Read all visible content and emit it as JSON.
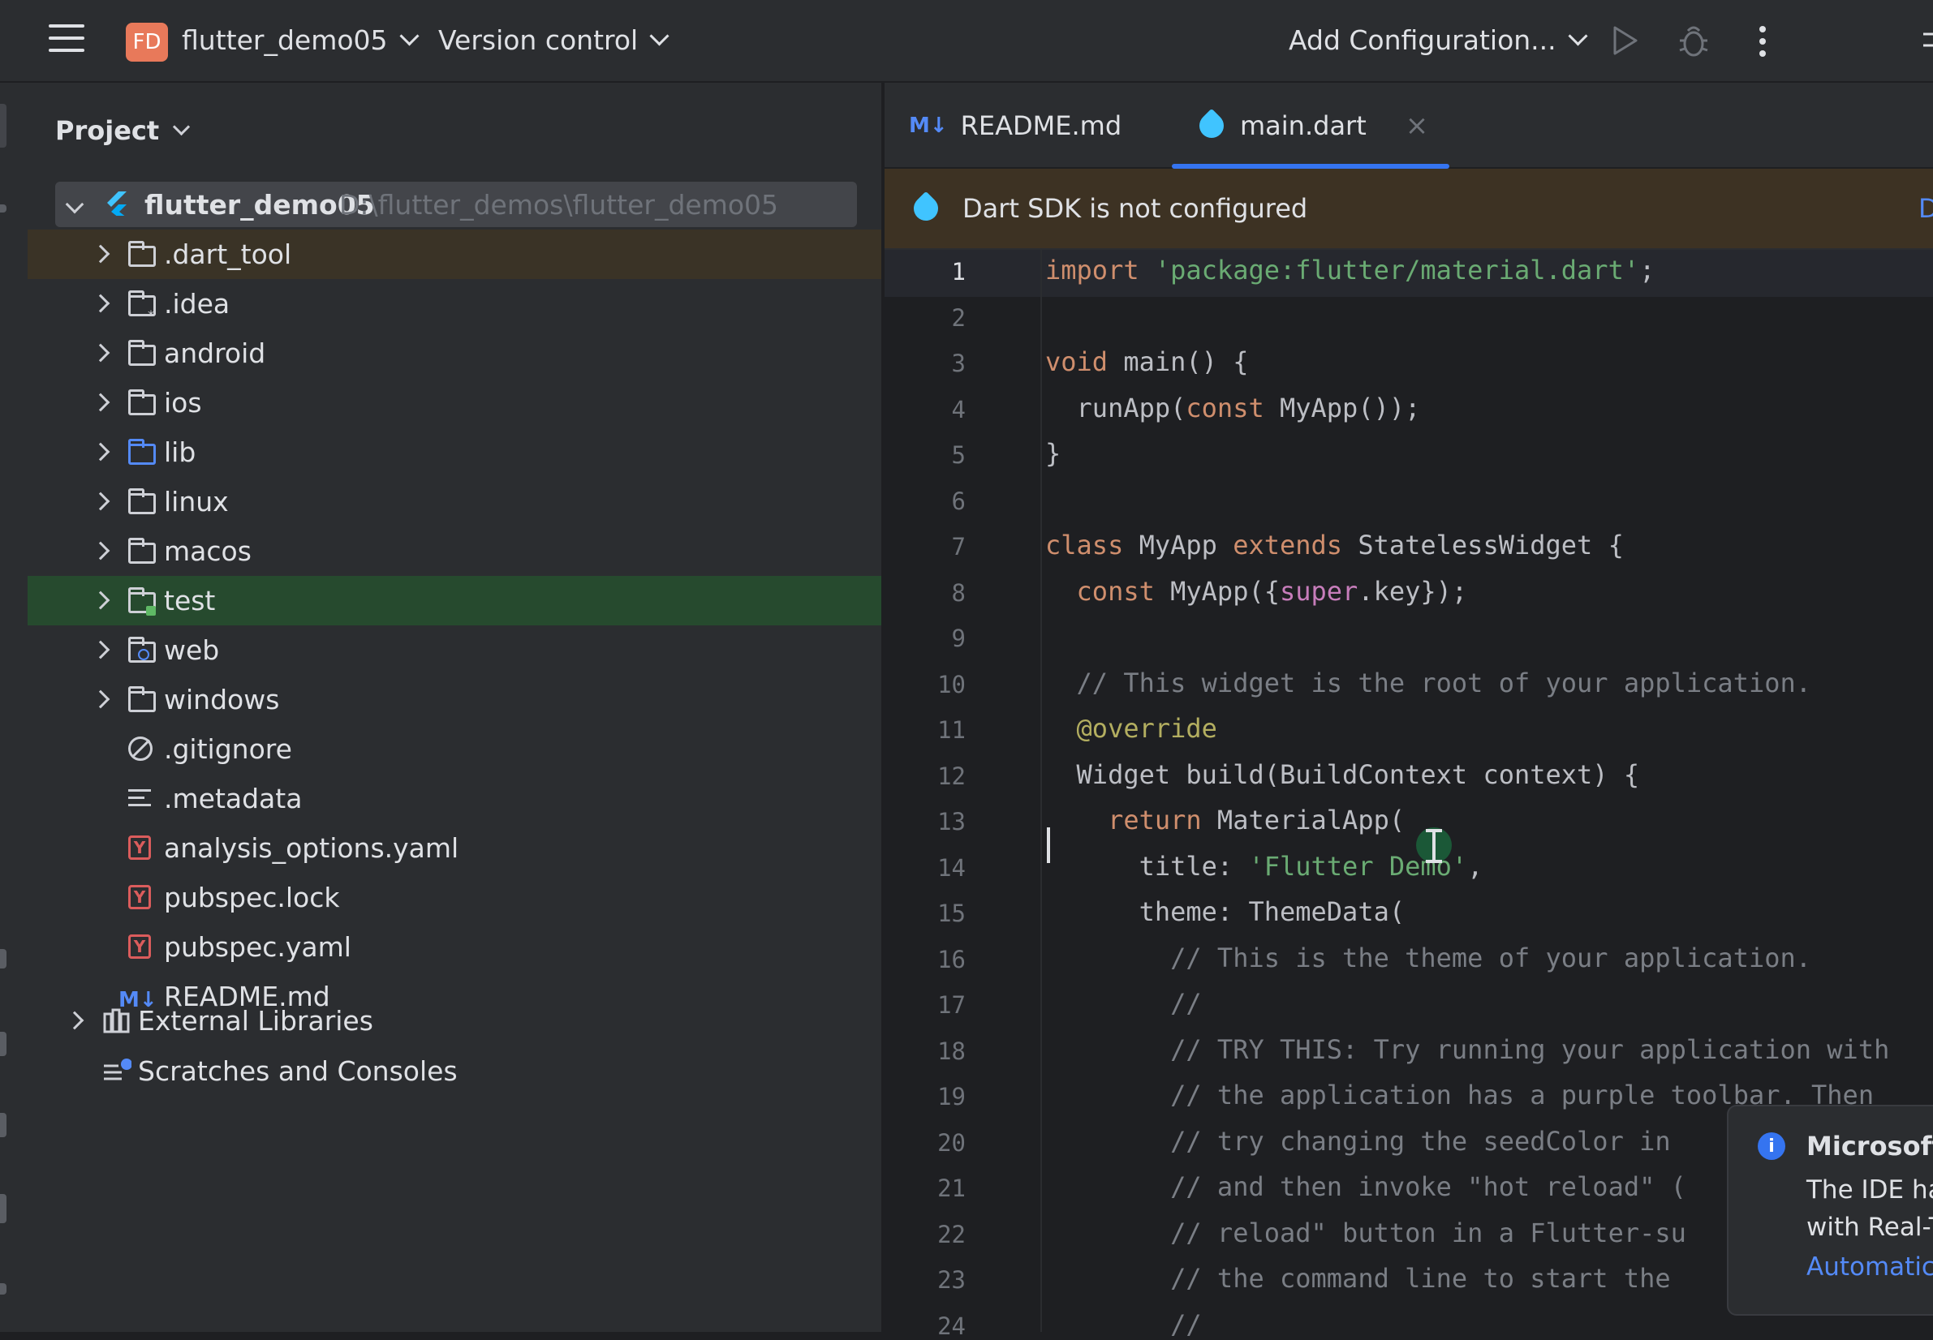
{
  "toolbar": {
    "project_badge": "FD",
    "project_name": "flutter_demo05",
    "vcs_label": "Version control",
    "run_config": "Add Configuration..."
  },
  "project_panel": {
    "title": "Project",
    "root": {
      "name": "flutter_demo05",
      "path": "D:\\flutter_demos\\flutter_demo05"
    },
    "items": [
      {
        "label": ".dart_tool",
        "icon": "folder-icon"
      },
      {
        "label": ".idea",
        "icon": "idea-folder-icon"
      },
      {
        "label": "android",
        "icon": "folder-icon"
      },
      {
        "label": "ios",
        "icon": "folder-icon"
      },
      {
        "label": "lib",
        "icon": "source-folder-icon"
      },
      {
        "label": "linux",
        "icon": "folder-icon"
      },
      {
        "label": "macos",
        "icon": "folder-icon"
      },
      {
        "label": "test",
        "icon": "test-folder-icon"
      },
      {
        "label": "web",
        "icon": "web-folder-icon"
      },
      {
        "label": "windows",
        "icon": "folder-icon"
      },
      {
        "label": ".gitignore",
        "icon": "gitignore-icon"
      },
      {
        "label": ".metadata",
        "icon": "text-file-icon"
      },
      {
        "label": "analysis_options.yaml",
        "icon": "yaml-icon"
      },
      {
        "label": "pubspec.lock",
        "icon": "yaml-icon"
      },
      {
        "label": "pubspec.yaml",
        "icon": "yaml-icon"
      },
      {
        "label": "README.md",
        "icon": "markdown-icon"
      }
    ],
    "external_libraries": "External Libraries",
    "scratches": "Scratches and Consoles"
  },
  "tabs": [
    {
      "icon_text": "M↓",
      "label": "README.md"
    },
    {
      "label": "main.dart",
      "close": "×"
    }
  ],
  "banner": {
    "text": "Dart SDK is not configured",
    "action": "D"
  },
  "code_lines": [
    "import 'package:flutter/material.dart';",
    "",
    "void main() {",
    "  runApp(const MyApp());",
    "}",
    "",
    "class MyApp extends StatelessWidget {",
    "  const MyApp({super.key});",
    "",
    "  // This widget is the root of your application.",
    "  @override",
    "  Widget build(BuildContext context) {",
    "    return MaterialApp(",
    "      title: 'Flutter Demo',",
    "      theme: ThemeData(",
    "        // This is the theme of your application.",
    "        //",
    "        // TRY THIS: Try running your application with",
    "        // the application has a purple toolbar. Then",
    "        // try changing the seedColor in",
    "        // and then invoke \"hot reload\" (",
    "        // reload\" button in a Flutter-su",
    "        // the command line to start the",
    "        //"
  ],
  "line_numbers": [
    "1",
    "2",
    "3",
    "4",
    "5",
    "6",
    "7",
    "8",
    "9",
    "10",
    "11",
    "12",
    "13",
    "14",
    "15",
    "16",
    "17",
    "18",
    "19",
    "20",
    "21",
    "22",
    "23",
    "24"
  ],
  "notification": {
    "info_glyph": "i",
    "title": "Microsoft",
    "body_line1": "The IDE ha",
    "body_line2": "with Real-T",
    "link": "Automatica"
  }
}
